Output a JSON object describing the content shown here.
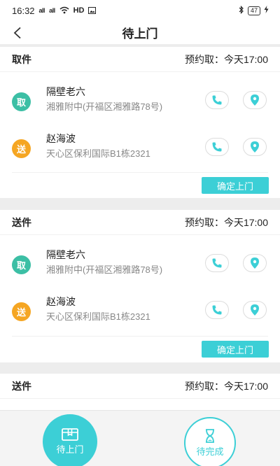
{
  "status": {
    "time": "16:32",
    "signal1": "all",
    "signal2": "all",
    "network": "HD",
    "battery": "47"
  },
  "header": {
    "title": "待上门"
  },
  "cards": [
    {
      "type": "取件",
      "time_label": "预约取：今天17:00",
      "contacts": [
        {
          "badge": "取",
          "name": "隔壁老六",
          "address": "湘雅附中(开福区湘雅路78号)"
        },
        {
          "badge": "送",
          "name": "赵海波",
          "address": "天心区保利国际B1栋2321"
        }
      ],
      "button_label": "确定上门"
    },
    {
      "type": "送件",
      "time_label": "预约取：今天17:00",
      "contacts": [
        {
          "badge": "取",
          "name": "隔壁老六",
          "address": "湘雅附中(开福区湘雅路78号)"
        },
        {
          "badge": "送",
          "name": "赵海波",
          "address": "天心区保利国际B1栋2321"
        }
      ],
      "button_label": "确定上门"
    },
    {
      "type": "送件",
      "time_label": "预约取：今天17:00"
    }
  ],
  "bottom_nav": {
    "pending_label": "待上门",
    "done_label": "待完成"
  },
  "colors": {
    "accent": "#3ccfd6",
    "take_badge": "#3cbfa5",
    "send_badge": "#f5a623"
  }
}
